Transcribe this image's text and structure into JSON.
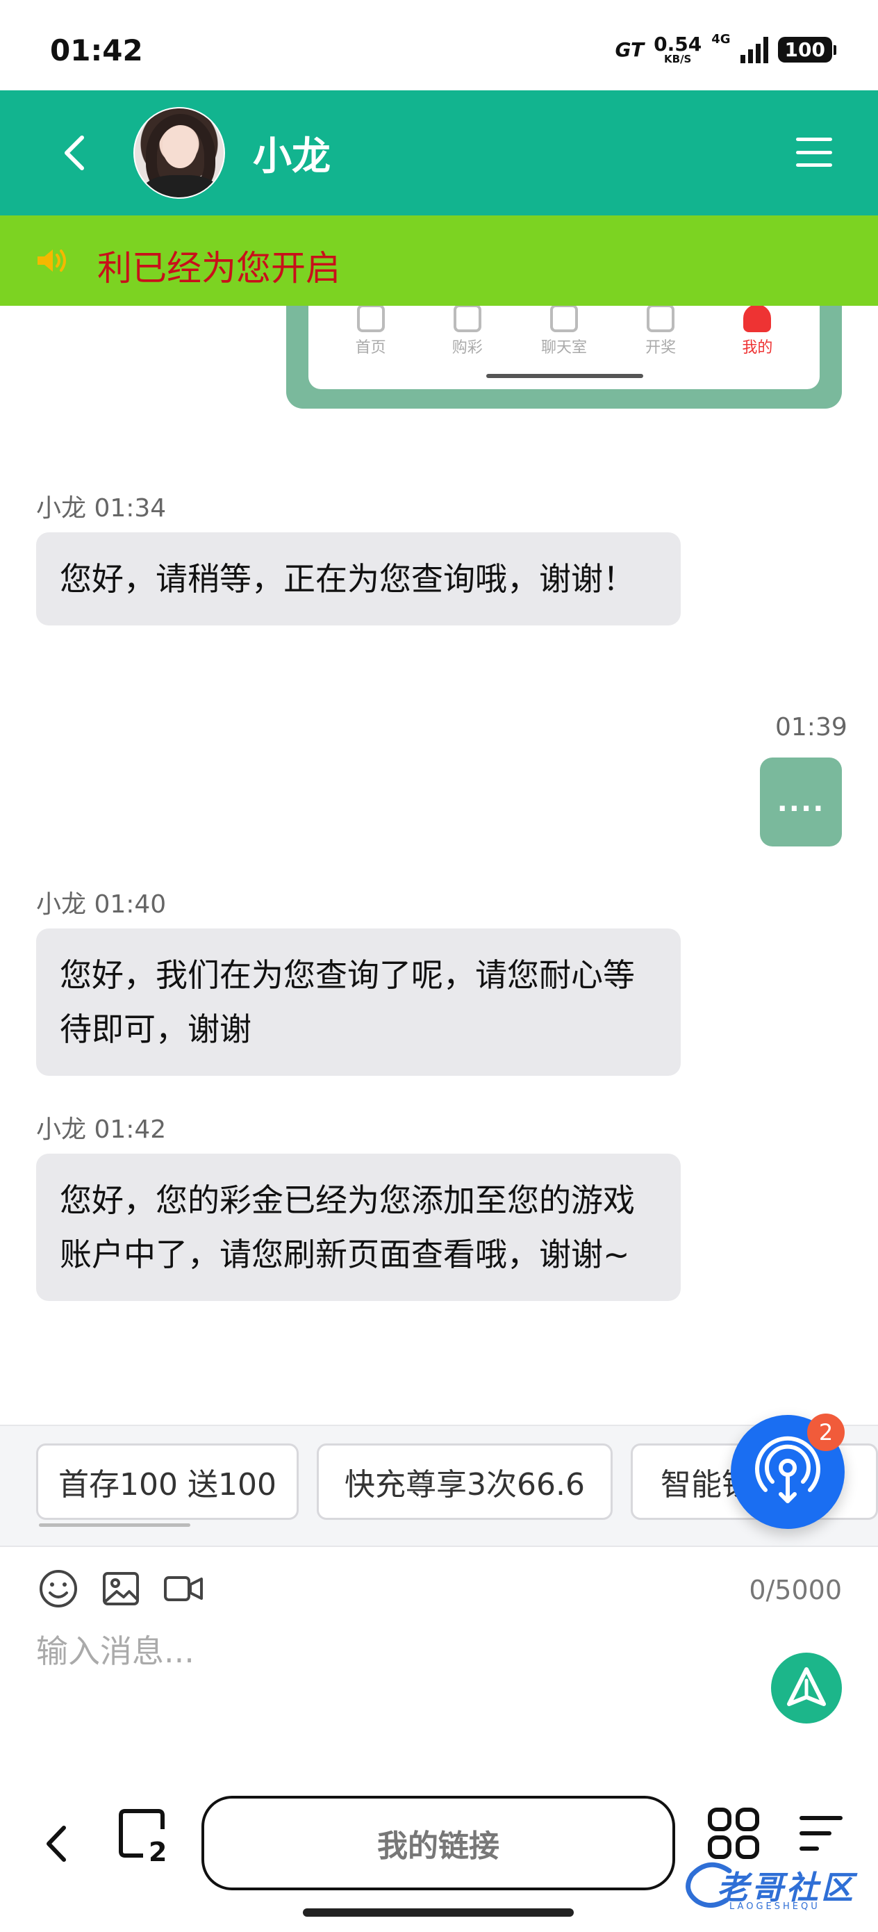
{
  "status_bar": {
    "time": "01:42",
    "speed_value": "0.54",
    "speed_unit": "KB/S",
    "network": "4G",
    "battery": "100",
    "brand": "GT"
  },
  "header": {
    "title": "小龙"
  },
  "notice": {
    "text": "利已经为您开启"
  },
  "image_preview": {
    "tabs": [
      {
        "label": "首页"
      },
      {
        "label": "购彩"
      },
      {
        "label": "聊天室"
      },
      {
        "label": "开奖"
      },
      {
        "label": "我的"
      }
    ]
  },
  "messages": [
    {
      "sender": "小龙",
      "time": "01:34",
      "text": "您好，请稍等，正在为您查询哦，谢谢！"
    },
    {
      "sender": "me",
      "time": "01:39",
      "text": "...."
    },
    {
      "sender": "小龙",
      "time": "01:40",
      "text": "您好，我们在为您查询了呢，请您耐心等待即可，谢谢"
    },
    {
      "sender": "小龙",
      "time": "01:42",
      "text": "您好，您的彩金已经为您添加至您的游戏账户中了，请您刷新页面查看哦，谢谢~"
    }
  ],
  "quick_replies": [
    {
      "label": "首存100 送100"
    },
    {
      "label": "快充尊享3次66.6"
    },
    {
      "label": "智能钱包"
    }
  ],
  "fab": {
    "badge": "2"
  },
  "composer": {
    "placeholder": "输入消息...",
    "counter": "0/5000"
  },
  "browser_nav": {
    "tab_count": "2",
    "url_label": "我的链接"
  },
  "watermark": {
    "text": "老哥社区",
    "sub": "LAOGESHEQU"
  },
  "colors": {
    "header": "#12b48f",
    "notice_bg": "#7cd322",
    "notice_text": "#c8101a",
    "my_bubble": "#7ab99c",
    "fab": "#1a6ef2",
    "send": "#1cb68a"
  }
}
